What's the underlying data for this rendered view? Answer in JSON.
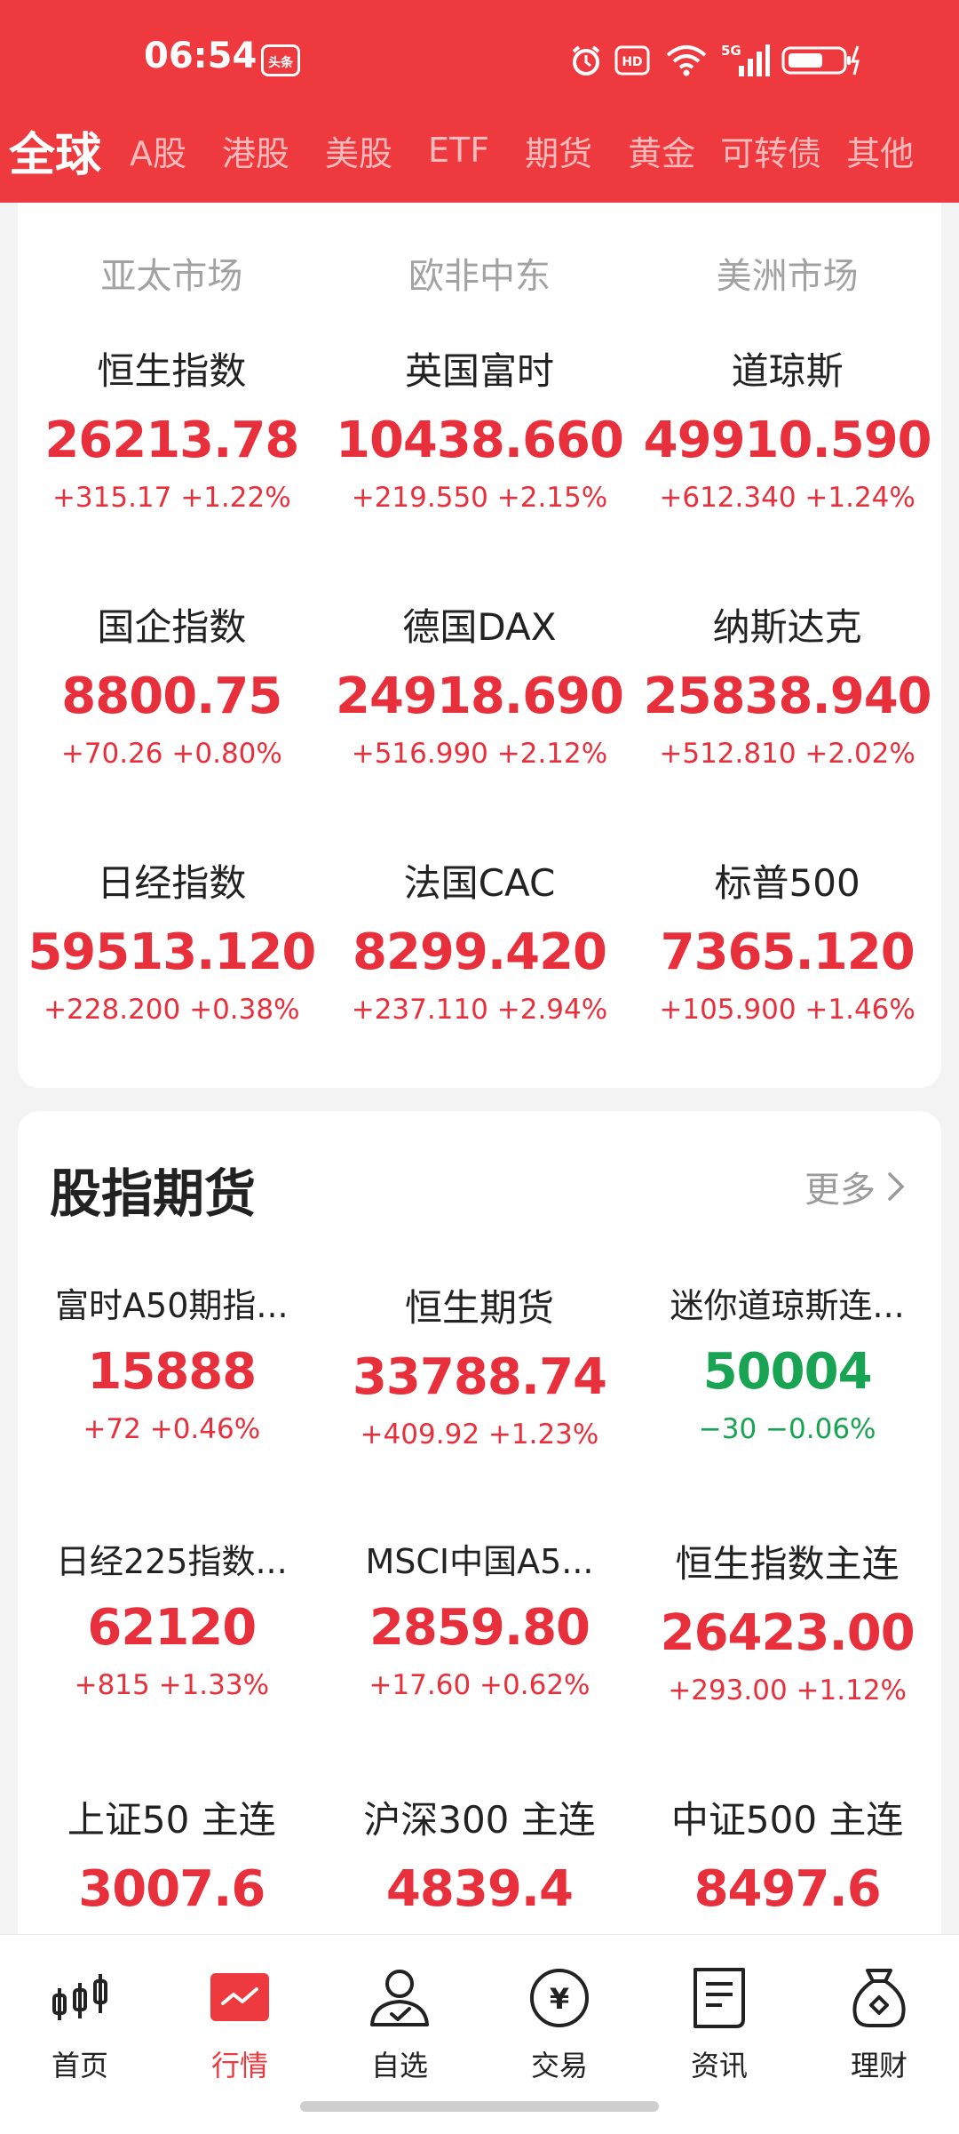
{
  "status_bar": {
    "time": "06:54",
    "notif_badge": "头条",
    "network": "5G",
    "hd": "HD"
  },
  "tabs": [
    {
      "label": "全球",
      "active": true
    },
    {
      "label": "A股"
    },
    {
      "label": "港股"
    },
    {
      "label": "美股"
    },
    {
      "label": "ETF"
    },
    {
      "label": "期货"
    },
    {
      "label": "黄金"
    },
    {
      "label": "可转债"
    },
    {
      "label": "其他"
    }
  ],
  "markets": {
    "regions": [
      "亚太市场",
      "欧非中东",
      "美洲市场"
    ],
    "items": [
      {
        "name": "恒生指数",
        "price": "26213.78",
        "change": "+315.17 +1.22%"
      },
      {
        "name": "英国富时",
        "price": "10438.660",
        "change": "+219.550 +2.15%"
      },
      {
        "name": "道琼斯",
        "price": "49910.590",
        "change": "+612.340 +1.24%"
      },
      {
        "name": "国企指数",
        "price": "8800.75",
        "change": "+70.26 +0.80%"
      },
      {
        "name": "德国DAX",
        "price": "24918.690",
        "change": "+516.990 +2.12%"
      },
      {
        "name": "纳斯达克",
        "price": "25838.940",
        "change": "+512.810 +2.02%"
      },
      {
        "name": "日经指数",
        "price": "59513.120",
        "change": "+228.200 +0.38%"
      },
      {
        "name": "法国CAC",
        "price": "8299.420",
        "change": "+237.110 +2.94%"
      },
      {
        "name": "标普500",
        "price": "7365.120",
        "change": "+105.900 +1.46%"
      }
    ]
  },
  "futures": {
    "title": "股指期货",
    "more": "更多",
    "items": [
      {
        "name": "富时A50期指...",
        "price": "15888",
        "change": "+72 +0.46%"
      },
      {
        "name": "恒生期货",
        "price": "33788.74",
        "change": "+409.92 +1.23%"
      },
      {
        "name": "迷你道琼斯连...",
        "price": "50004",
        "change": "−30 −0.06%",
        "down": true
      },
      {
        "name": "日经225指数...",
        "price": "62120",
        "change": "+815 +1.33%"
      },
      {
        "name": "MSCI中国A5...",
        "price": "2859.80",
        "change": "+17.60 +0.62%"
      },
      {
        "name": "恒生指数主连",
        "price": "26423.00",
        "change": "+293.00 +1.12%"
      },
      {
        "name": "上证50 主连",
        "price": "3007.6",
        "change": ""
      },
      {
        "name": "沪深300 主连",
        "price": "4839.4",
        "change": ""
      },
      {
        "name": "中证500 主连",
        "price": "8497.6",
        "change": ""
      }
    ]
  },
  "nav": [
    {
      "label": "首页",
      "icon": "candlestick-icon"
    },
    {
      "label": "行情",
      "icon": "market-chart-icon",
      "active": true
    },
    {
      "label": "自选",
      "icon": "user-check-icon"
    },
    {
      "label": "交易",
      "icon": "yen-coin-icon"
    },
    {
      "label": "资讯",
      "icon": "news-document-icon"
    },
    {
      "label": "理财",
      "icon": "money-bag-icon"
    }
  ],
  "colors": {
    "brand_red": "#ee3a3e",
    "up_red": "#e8303c",
    "down_green": "#18a452"
  }
}
